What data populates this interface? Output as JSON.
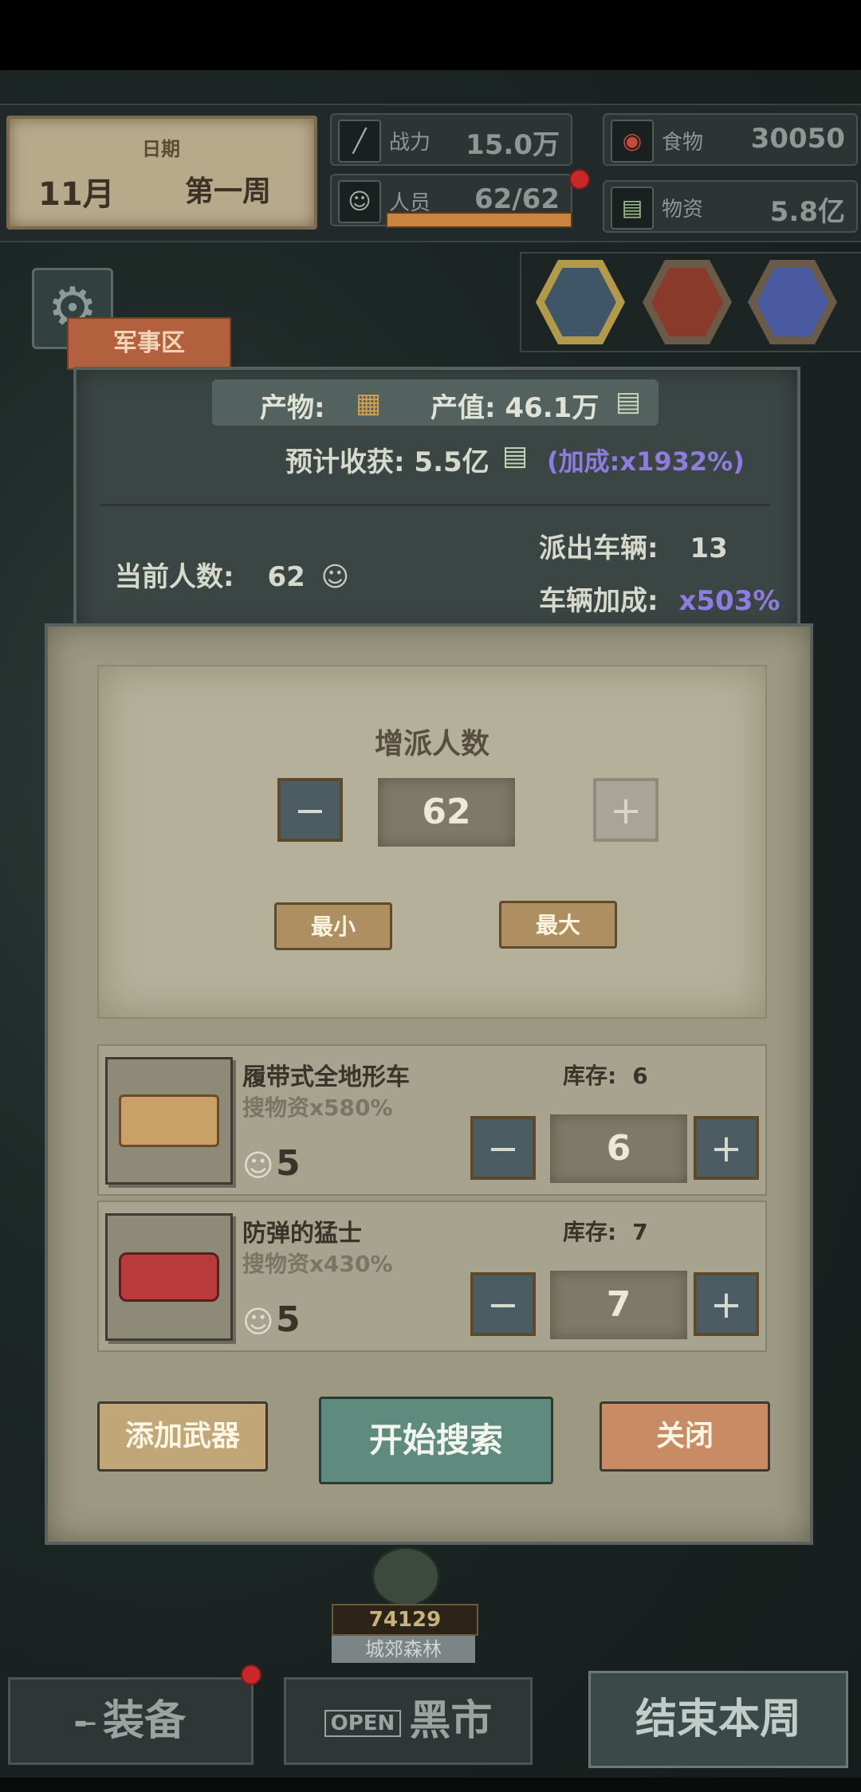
{
  "header": {
    "date_label": "日期",
    "month": "11月",
    "week": "第一周",
    "combat_label": "战力",
    "combat_value": "15.0万",
    "people_label": "人员",
    "people_value": "62/62",
    "people_fill": 1.0,
    "food_label": "食物",
    "food_value": "30050",
    "supplies_label": "物资",
    "supplies_value": "5.8亿"
  },
  "zone": {
    "tab": "军事区",
    "output_label": "产物:",
    "output_value_label": "产值: 46.1万",
    "harvest": "预计收获: 5.5亿",
    "bonus": "(加成:x1932%)",
    "current_people_label": "当前人数:",
    "current_people": "62",
    "vehicles_out_label": "派出车辆:",
    "vehicles_out": "13",
    "vehicle_bonus_label": "车辆加成:",
    "vehicle_bonus": "x503%"
  },
  "assign": {
    "title": "增派人数",
    "minus": "−",
    "count": "62",
    "plus": "+",
    "min_label": "最小",
    "max_label": "最大"
  },
  "vehicles": [
    {
      "name": "履带式全地形车",
      "bonus": "搜物资x580%",
      "crew": "5",
      "stock_label": "库存:",
      "stock": "6",
      "count": "6"
    },
    {
      "name": "防弹的猛士",
      "bonus": "搜物资x430%",
      "crew": "5",
      "stock_label": "库存:",
      "stock": "7",
      "count": "7"
    }
  ],
  "actions": {
    "add_weapon": "添加武器",
    "start_search": "开始搜索",
    "close": "关闭"
  },
  "map": {
    "score": "74129",
    "place": "城郊森林"
  },
  "nav": {
    "equipment": "装备",
    "open_sign": "OPEN",
    "black_market": "黑市",
    "end_week": "结束本周"
  }
}
